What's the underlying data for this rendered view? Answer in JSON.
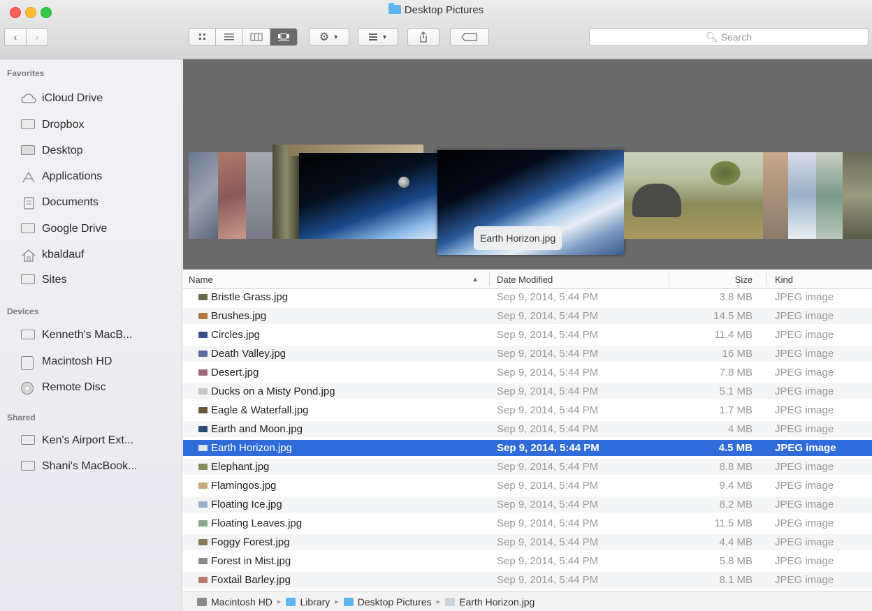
{
  "window": {
    "title": "Desktop Pictures"
  },
  "toolbar": {
    "back_label": "‹",
    "forward_label": "›",
    "view_modes": [
      "icon",
      "list",
      "column",
      "coverflow"
    ],
    "search_placeholder": "Search"
  },
  "sidebar": {
    "favorites_label": "Favorites",
    "favorites": [
      {
        "label": "iCloud Drive",
        "icon": "cloud-icon"
      },
      {
        "label": "Dropbox",
        "icon": "folder-icon"
      },
      {
        "label": "Desktop",
        "icon": "desktop-icon"
      },
      {
        "label": "Applications",
        "icon": "applications-icon"
      },
      {
        "label": "Documents",
        "icon": "document-icon"
      },
      {
        "label": "Google Drive",
        "icon": "folder-icon"
      },
      {
        "label": "kbaldauf",
        "icon": "home-icon"
      },
      {
        "label": "Sites",
        "icon": "folder-icon"
      }
    ],
    "devices_label": "Devices",
    "devices": [
      {
        "label": "Kenneth's MacB...",
        "icon": "laptop-icon"
      },
      {
        "label": "Macintosh HD",
        "icon": "hard-drive-icon"
      },
      {
        "label": "Remote Disc",
        "icon": "disc-icon"
      }
    ],
    "shared_label": "Shared",
    "shared": [
      {
        "label": "Ken's Airport Ext...",
        "icon": "display-icon"
      },
      {
        "label": "Shani's MacBook...",
        "icon": "display-icon"
      }
    ]
  },
  "coverflow": {
    "caption": "Earth Horizon.jpg"
  },
  "list": {
    "columns": {
      "name": "Name",
      "date": "Date Modified",
      "size": "Size",
      "kind": "Kind"
    },
    "rows": [
      {
        "name": "Bristle Grass.jpg",
        "date": "Sep 9, 2014, 5:44 PM",
        "size": "3.8 MB",
        "kind": "JPEG image",
        "color": "#6b6b4a"
      },
      {
        "name": "Brushes.jpg",
        "date": "Sep 9, 2014, 5:44 PM",
        "size": "14.5 MB",
        "kind": "JPEG image",
        "color": "#b07a3a"
      },
      {
        "name": "Circles.jpg",
        "date": "Sep 9, 2014, 5:44 PM",
        "size": "11.4 MB",
        "kind": "JPEG image",
        "color": "#3a4f8a"
      },
      {
        "name": "Death Valley.jpg",
        "date": "Sep 9, 2014, 5:44 PM",
        "size": "16 MB",
        "kind": "JPEG image",
        "color": "#5a6a9a"
      },
      {
        "name": "Desert.jpg",
        "date": "Sep 9, 2014, 5:44 PM",
        "size": "7.8 MB",
        "kind": "JPEG image",
        "color": "#9a6a7a"
      },
      {
        "name": "Ducks on a Misty Pond.jpg",
        "date": "Sep 9, 2014, 5:44 PM",
        "size": "5.1 MB",
        "kind": "JPEG image",
        "color": "#c8c8c0"
      },
      {
        "name": "Eagle & Waterfall.jpg",
        "date": "Sep 9, 2014, 5:44 PM",
        "size": "1.7 MB",
        "kind": "JPEG image",
        "color": "#6a5a3a"
      },
      {
        "name": "Earth and Moon.jpg",
        "date": "Sep 9, 2014, 5:44 PM",
        "size": "4 MB",
        "kind": "JPEG image",
        "color": "#2a4a7a"
      },
      {
        "name": "Earth Horizon.jpg",
        "date": "Sep 9, 2014, 5:44 PM",
        "size": "4.5 MB",
        "kind": "JPEG image",
        "color": "#dde4ee",
        "selected": true
      },
      {
        "name": "Elephant.jpg",
        "date": "Sep 9, 2014, 5:44 PM",
        "size": "8.8 MB",
        "kind": "JPEG image",
        "color": "#8a8a5a"
      },
      {
        "name": "Flamingos.jpg",
        "date": "Sep 9, 2014, 5:44 PM",
        "size": "9.4 MB",
        "kind": "JPEG image",
        "color": "#c8a87a"
      },
      {
        "name": "Floating Ice.jpg",
        "date": "Sep 9, 2014, 5:44 PM",
        "size": "8.2 MB",
        "kind": "JPEG image",
        "color": "#9ab0c8"
      },
      {
        "name": "Floating Leaves.jpg",
        "date": "Sep 9, 2014, 5:44 PM",
        "size": "11.5 MB",
        "kind": "JPEG image",
        "color": "#8aa88a"
      },
      {
        "name": "Foggy Forest.jpg",
        "date": "Sep 9, 2014, 5:44 PM",
        "size": "4.4 MB",
        "kind": "JPEG image",
        "color": "#8a7a5a"
      },
      {
        "name": "Forest in Mist.jpg",
        "date": "Sep 9, 2014, 5:44 PM",
        "size": "5.8 MB",
        "kind": "JPEG image",
        "color": "#8a8a8a"
      },
      {
        "name": "Foxtail Barley.jpg",
        "date": "Sep 9, 2014, 5:44 PM",
        "size": "8.1 MB",
        "kind": "JPEG image",
        "color": "#b87a6a"
      }
    ]
  },
  "pathbar": {
    "segments": [
      {
        "label": "Macintosh HD",
        "color": "#8a8a8a"
      },
      {
        "label": "Library",
        "color": "#5fb5f0"
      },
      {
        "label": "Desktop Pictures",
        "color": "#5fb5f0"
      },
      {
        "label": "Earth Horizon.jpg",
        "color": "#c8d4e4"
      }
    ]
  },
  "colors": {
    "selection": "#2f6bd9",
    "coverflow_bg": "#6a6a6a"
  }
}
